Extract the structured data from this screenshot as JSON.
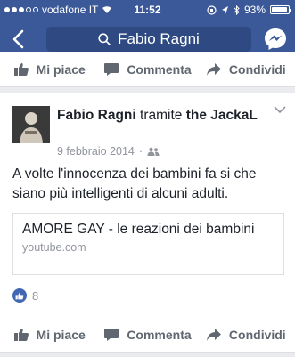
{
  "status_bar": {
    "carrier": "vodafone IT",
    "time": "11:52",
    "battery": "93%",
    "battery_level": 0.93
  },
  "search": {
    "query": "Fabio Ragni"
  },
  "actions": {
    "like": "Mi piace",
    "comment": "Commenta",
    "share": "Condividi"
  },
  "post": {
    "author": "Fabio Ragni",
    "via_word": "tramite",
    "via_page": "the JackaL",
    "date": "9 febbraio 2014",
    "separator": "·",
    "text": "A volte l'innocenza dei bambini fa si che siano più intelligenti di alcuni adulti.",
    "link": {
      "title": "AMORE GAY - le reazioni dei bambini",
      "domain": "youtube.com"
    },
    "like_count": "8"
  },
  "colors": {
    "brand": "#3b5998",
    "like_blue": "#4267b2",
    "muted": "#90949c"
  }
}
